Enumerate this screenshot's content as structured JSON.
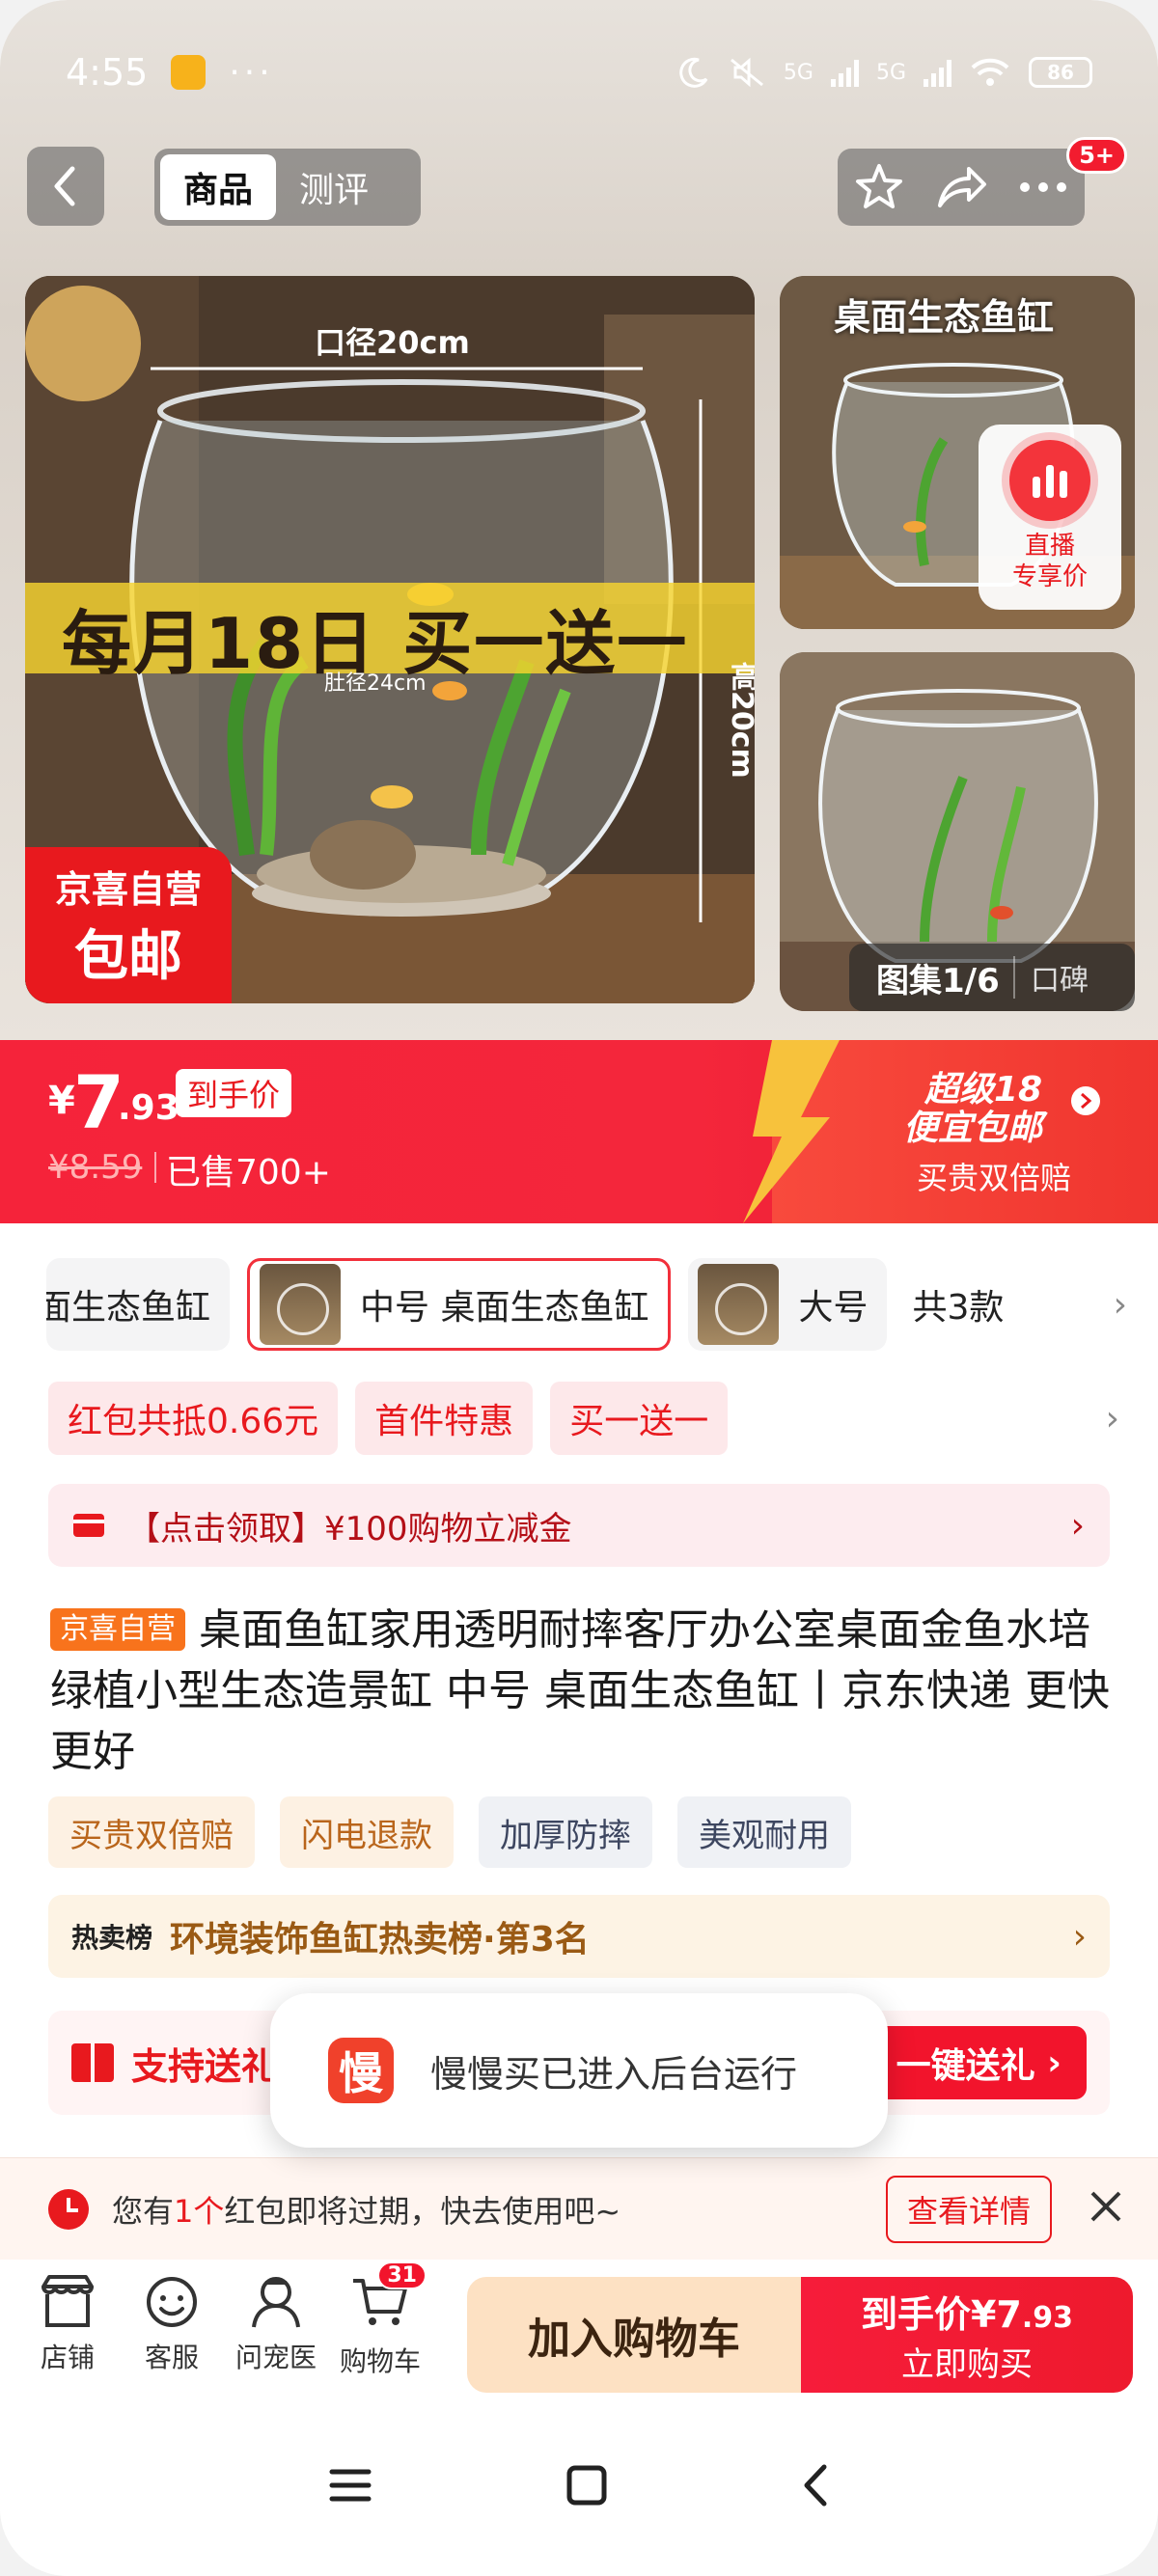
{
  "status_bar": {
    "time": "4:55",
    "more": "···",
    "network1": "5G",
    "network2": "5G",
    "battery": "86"
  },
  "nav": {
    "tabs": [
      {
        "label": "商品",
        "active": true
      },
      {
        "label": "测评",
        "active": false
      }
    ],
    "badge": "5+"
  },
  "gallery": {
    "main_promo": "每月18日 买一送一",
    "dim_top": "口径20cm",
    "dim_belly": "肚径24cm",
    "dim_height": "高20cm",
    "badge_line1": "京喜自营",
    "badge_line2": "包邮",
    "thumb_title": "桌面生态鱼缸",
    "live_line1": "直播",
    "live_line2": "专享价",
    "counter": "图集1/6",
    "reviews": "口碑"
  },
  "price": {
    "currency": "¥",
    "integer": "7",
    "decimal": ".93",
    "label": "到手价",
    "original": "¥8.59",
    "sold": "已售700+",
    "promo_line1": "超级18",
    "promo_line2": "便宜包邮",
    "promo_sub": "买贵双倍赔",
    "accent_color": "#f4263b"
  },
  "variants": {
    "items": [
      {
        "label": "桌面生态鱼缸",
        "selected": false
      },
      {
        "label": "中号  桌面生态鱼缸",
        "selected": true
      },
      {
        "label": "大号",
        "selected": false
      }
    ],
    "total": "共3款"
  },
  "promo_tags": [
    "红包共抵0.66元",
    "首件特惠",
    "买一送一"
  ],
  "coupon": {
    "text": "【点击领取】¥100购物立减金"
  },
  "product": {
    "badge": "京喜自营",
    "title": "桌面鱼缸家用透明耐摔客厅办公室桌面金鱼水培绿植小型生态造景缸 中号  桌面生态鱼缸丨京东快递 更快更好"
  },
  "services": [
    {
      "label": "买贵双倍赔",
      "style": "warm"
    },
    {
      "label": "闪电退款",
      "style": "warm"
    },
    {
      "label": "加厚防摔",
      "style": "cool"
    },
    {
      "label": "美观耐用",
      "style": "cool"
    }
  ],
  "ranking": {
    "label": "热卖榜",
    "text": "环境装饰鱼缸热卖榜·第3名"
  },
  "gift": {
    "text": "支持送礼",
    "button": "一键送礼"
  },
  "toast": {
    "logo": "慢",
    "text": "慢慢买已进入后台运行"
  },
  "expire": {
    "pre": "您有",
    "count": "1个",
    "post": "红包即将过期，快去使用吧~",
    "button": "查看详情"
  },
  "bottom_bar": {
    "items": [
      {
        "label": "店铺",
        "icon": "store-icon"
      },
      {
        "label": "客服",
        "icon": "customer-service-icon"
      },
      {
        "label": "问宠医",
        "icon": "pet-doctor-icon"
      },
      {
        "label": "购物车",
        "icon": "cart-icon"
      }
    ],
    "cart_count": "31",
    "add_cart": "加入购物车",
    "buy_label": "到手价",
    "buy_price": "¥7",
    "buy_price_dec": ".93",
    "buy_sub": "立即购买"
  }
}
